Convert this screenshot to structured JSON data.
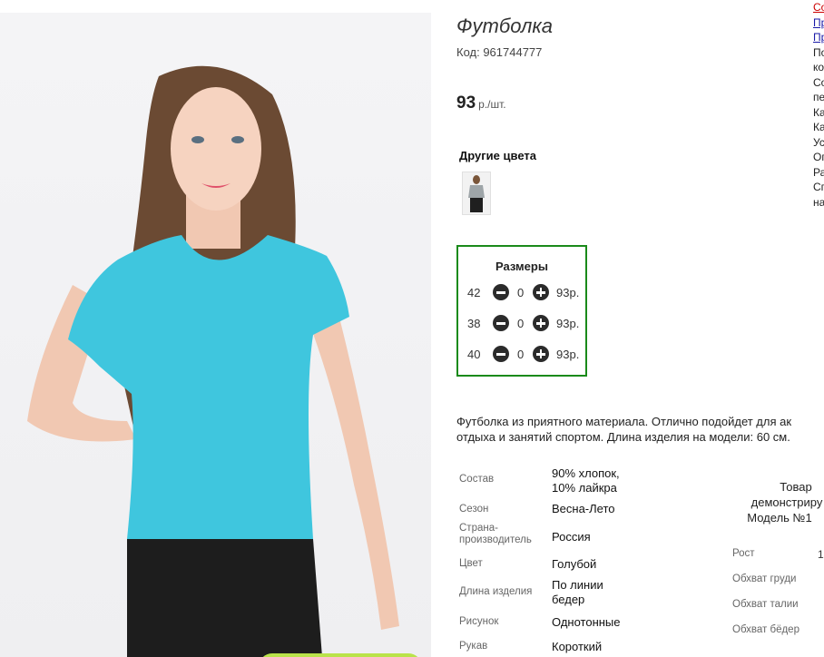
{
  "product": {
    "title": "Футболка",
    "code": "Код: 961744777",
    "price_value": "93",
    "price_unit": "р./шт."
  },
  "other_colors": {
    "title": "Другие цвета"
  },
  "sizes": {
    "title": "Размеры",
    "rows": [
      {
        "size": "42",
        "qty": "0",
        "price": "93р."
      },
      {
        "size": "38",
        "qty": "0",
        "price": "93р."
      },
      {
        "size": "40",
        "qty": "0",
        "price": "93р."
      }
    ]
  },
  "description": {
    "line1": "Футболка из приятного материала. Отлично подойдет для ак",
    "line2": "отдыха и занятий спортом. Длина изделия на модели: 60 см."
  },
  "specs": [
    {
      "label": "Состав",
      "value": "90% хлопок, 10% лайкра"
    },
    {
      "label": "Сезон",
      "value": "Весна-Лето"
    },
    {
      "label": "Страна-производитель",
      "value": "Россия"
    },
    {
      "label": "Цвет",
      "value": "Голубой"
    },
    {
      "label": "Длина изделия",
      "value": "По линии бедер"
    },
    {
      "label": "Рисунок",
      "value": "Однотонные"
    },
    {
      "label": "Рукав",
      "value": "Короткий"
    }
  ],
  "model": {
    "line1": "Товар",
    "line2": "демонстриру",
    "line3": "Модель №1",
    "measures": [
      {
        "label": "Рост",
        "value": "1"
      },
      {
        "label": "Обхват груди",
        "value": ""
      },
      {
        "label": "Обхват талии",
        "value": ""
      },
      {
        "label": "Обхват бёдер",
        "value": ""
      }
    ]
  },
  "right_nav": {
    "items": [
      "Со",
      "Пр",
      "Пр",
      "По",
      "ко",
      "Со",
      "пе",
      "Ка",
      "Ка",
      "Ус",
      "Оп",
      "Ра",
      "Сп",
      "на"
    ],
    "colors": [
      "#cc0000",
      "#1a1aa8",
      "#1a1aa8",
      "#222222",
      "#222222",
      "#222222",
      "#222222",
      "#222222",
      "#222222",
      "#222222",
      "#222222",
      "#222222",
      "#222222",
      "#222222"
    ]
  }
}
